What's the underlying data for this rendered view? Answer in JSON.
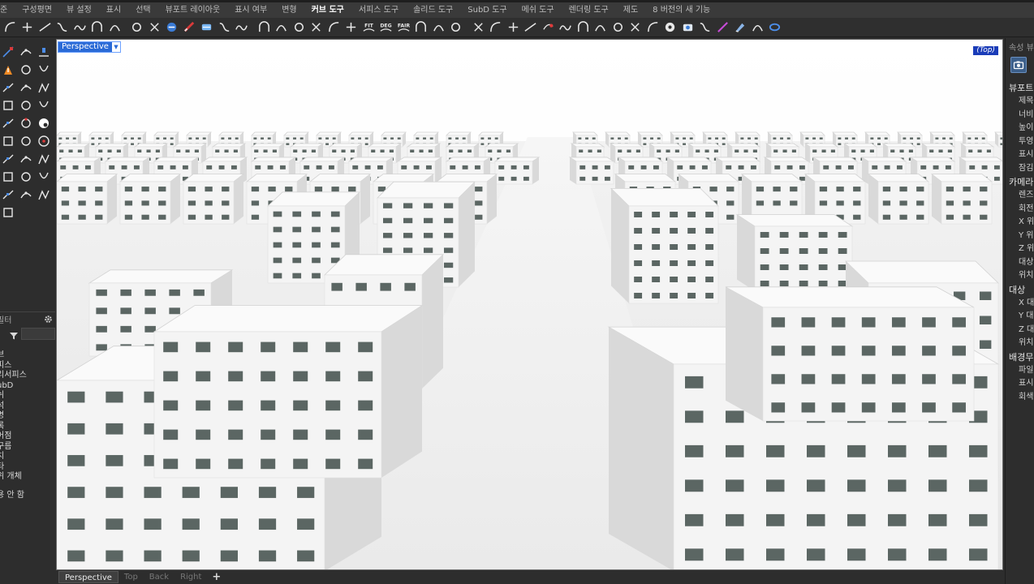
{
  "menu_tabs": [
    {
      "label": "준",
      "active": false
    },
    {
      "label": "구성평면",
      "active": false
    },
    {
      "label": "뷰 설정",
      "active": false
    },
    {
      "label": "표시",
      "active": false
    },
    {
      "label": "선택",
      "active": false
    },
    {
      "label": "뷰포트 레이아웃",
      "active": false
    },
    {
      "label": "표시 여부",
      "active": false
    },
    {
      "label": "변형",
      "active": false
    },
    {
      "label": "커브 도구",
      "active": true
    },
    {
      "label": "서피스 도구",
      "active": false
    },
    {
      "label": "솔리드 도구",
      "active": false
    },
    {
      "label": "SubD 도구",
      "active": false
    },
    {
      "label": "메쉬 도구",
      "active": false
    },
    {
      "label": "렌더링 도구",
      "active": false
    },
    {
      "label": "제도",
      "active": false
    },
    {
      "label": "8 버전의 새 기능",
      "active": false
    }
  ],
  "toolbar_icons": [
    "fillet-curve-icon",
    "perpendicular-icon",
    "line-icon",
    "offset-icon",
    "blend-icon",
    "wave-icon",
    "arch-icon",
    "curve-tool-icon",
    "adjust-seam-icon",
    "rebuild-icon",
    "extract-icon",
    "match-icon",
    "refit-icon",
    "dash-icon",
    "curvature-graph-icon",
    "tangent-icon",
    "network-icon",
    "handle-icon",
    "anchor-icon",
    "human-icon",
    "fit-icon",
    "deg-icon",
    "fair-icon",
    "circle-tool-icon",
    "dimension-icon",
    "dimension-text-icon",
    "loop-icon",
    "point-target-icon",
    "bend-icon",
    "spline-icon",
    "trim-red-icon",
    "curve-arrow-icon",
    "hook-icon",
    "arc-icon",
    "smooth-icon",
    "contour-icon",
    "wave-fill-icon",
    "circle-dot-icon",
    "projector-icon",
    "arc-line-icon",
    "pen-icon",
    "paint-icon",
    "list-icon",
    "panel-icon"
  ],
  "toolbar_text_icons": {
    "fit": "FIT",
    "deg": "DEG",
    "fair": "FAIR"
  },
  "left_tools": [
    "select-points-icon",
    "curve-points-icon",
    "control-points-icon",
    "explode-icon",
    "polyline-icon",
    "rectangle-points-icon",
    "chain-icon",
    "curve-blend-icon",
    "v-curve-icon",
    "arc-curve-icon",
    "hexagon-curve-icon",
    "line-tool-icon",
    "hook-curve-icon",
    "circle-snap-icon",
    "sphere-icon",
    "gear-shape-icon",
    "circle-slash-icon",
    "circle-target-icon",
    "arc-small-icon",
    "angle-curve-icon",
    "spiral-icon",
    "ellipse-icon",
    "rectangle-icon",
    "box-icon",
    "frame-icon",
    "target-plus-icon",
    "square-dot-icon",
    "star-icon"
  ],
  "filter_panel": {
    "title": "필터",
    "items": [
      "브",
      "피스",
      "리서피스",
      "ubD",
      "쉬",
      "석",
      "명",
      "록",
      "어점",
      "구름",
      "치",
      "타",
      "위 개체"
    ],
    "footer": "용 안 함"
  },
  "right_panel": {
    "header": "속성 뷰",
    "items": [
      {
        "label": "뷰포트",
        "section": true
      },
      {
        "label": "제목",
        "section": false
      },
      {
        "label": "너비",
        "section": false
      },
      {
        "label": "높이",
        "section": false
      },
      {
        "label": "투영",
        "section": false
      },
      {
        "label": "표시",
        "section": false
      },
      {
        "label": "잠김",
        "section": false
      },
      {
        "label": "카메라",
        "section": true
      },
      {
        "label": "렌즈",
        "section": false
      },
      {
        "label": "회전",
        "section": false
      },
      {
        "label": "X 위",
        "section": false
      },
      {
        "label": "Y 위",
        "section": false
      },
      {
        "label": "Z 위",
        "section": false
      },
      {
        "label": "대상",
        "section": false
      },
      {
        "label": "위치",
        "section": false
      },
      {
        "label": "대상",
        "section": true
      },
      {
        "label": "X 대",
        "section": false
      },
      {
        "label": "Y 대",
        "section": false
      },
      {
        "label": "Z 대",
        "section": false
      },
      {
        "label": "위치",
        "section": false
      },
      {
        "label": "배경무",
        "section": true
      },
      {
        "label": "파일",
        "section": false
      },
      {
        "label": "표시",
        "section": false
      },
      {
        "label": "회색",
        "section": false
      }
    ]
  },
  "viewport": {
    "label": "Perspective",
    "dropdown_glyph": "▼",
    "corner_label": "(Top)"
  },
  "bottom_tabs": [
    {
      "label": "Perspective",
      "active": true
    },
    {
      "label": "Top",
      "active": false
    },
    {
      "label": "Back",
      "active": false
    },
    {
      "label": "Right",
      "active": false
    }
  ],
  "bottom_add": "+",
  "colors": {
    "active_tab": "#ffffff",
    "viewport_label_bg": "#2a6ad6",
    "corner_label_bg": "#1a3cb8",
    "panel_bg": "#2d2d2d",
    "window_glass": "#5b6663",
    "building_face_light": "#f4f4f4",
    "building_face_shade": "#d9d9d9"
  }
}
